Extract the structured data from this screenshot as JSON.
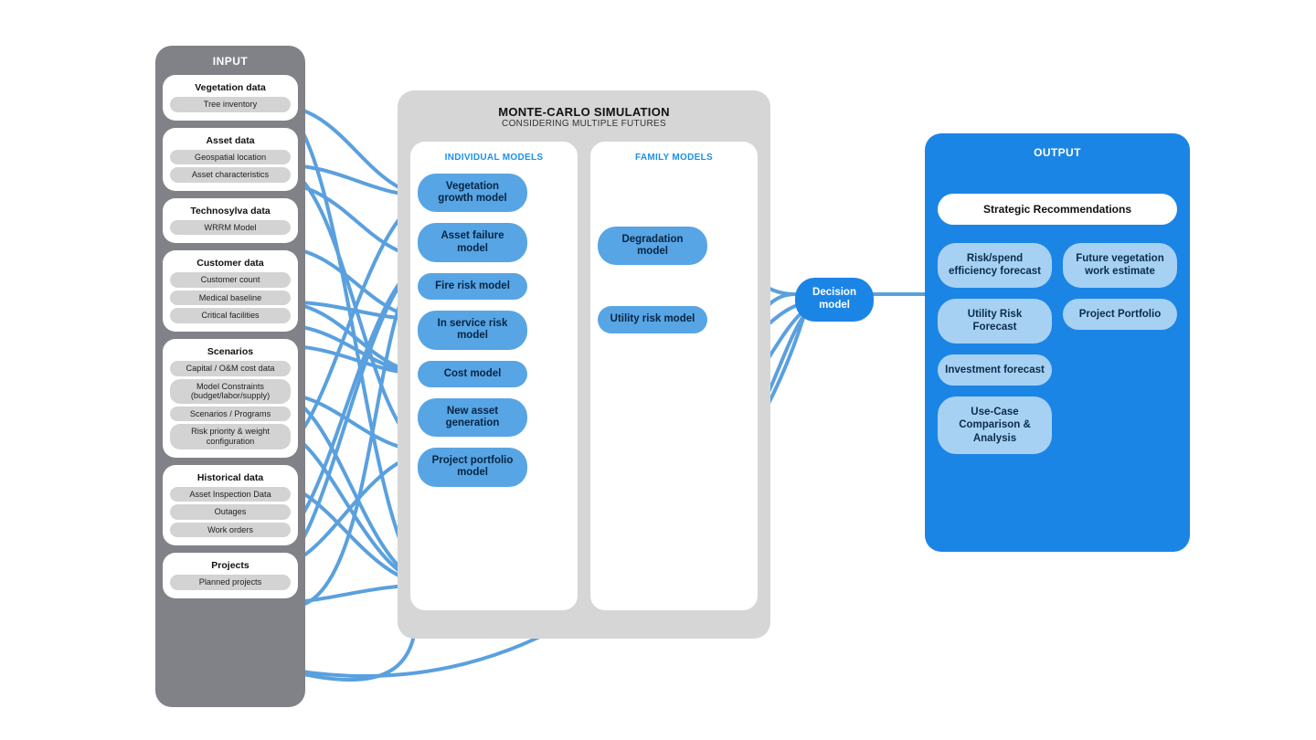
{
  "input": {
    "title": "INPUT",
    "sections": [
      {
        "title": "Vegetation data",
        "items": [
          "Tree inventory"
        ]
      },
      {
        "title": "Asset data",
        "items": [
          "Geospatial location",
          "Asset characteristics"
        ]
      },
      {
        "title": "Technosylva data",
        "items": [
          "WRRM Model"
        ]
      },
      {
        "title": "Customer data",
        "items": [
          "Customer count",
          "Medical baseline",
          "Critical facilities"
        ]
      },
      {
        "title": "Scenarios",
        "items": [
          "Capital / O&M cost data",
          "Model Constraints (budget/labor/supply)",
          "Scenarios / Programs",
          "Risk priority & weight configuration"
        ]
      },
      {
        "title": "Historical data",
        "items": [
          "Asset Inspection Data",
          "Outages",
          "Work orders"
        ]
      },
      {
        "title": "Projects",
        "items": [
          "Planned projects"
        ]
      }
    ]
  },
  "simulation": {
    "title": "MONTE-CARLO SIMULATION",
    "subtitle": "CONSIDERING MULTIPLE FUTURES",
    "individualLabel": "INDIVIDUAL MODELS",
    "familyLabel": "FAMILY MODELS",
    "individual": [
      "Vegetation growth model",
      "Asset failure model",
      "Fire risk model",
      "In service risk model",
      "Cost model",
      "New asset generation",
      "Project portfolio model"
    ],
    "family": [
      "Degradation model",
      "Utility risk model"
    ]
  },
  "decision": "Decision model",
  "output": {
    "title": "OUTPUT",
    "header": "Strategic Recommendations",
    "left": [
      "Risk/spend efficiency forecast",
      "Utility Risk Forecast",
      "Investment forecast",
      "Use-Case Comparison & Analysis"
    ],
    "right": [
      "Future vegetation work estimate",
      "Project Portfolio"
    ]
  }
}
